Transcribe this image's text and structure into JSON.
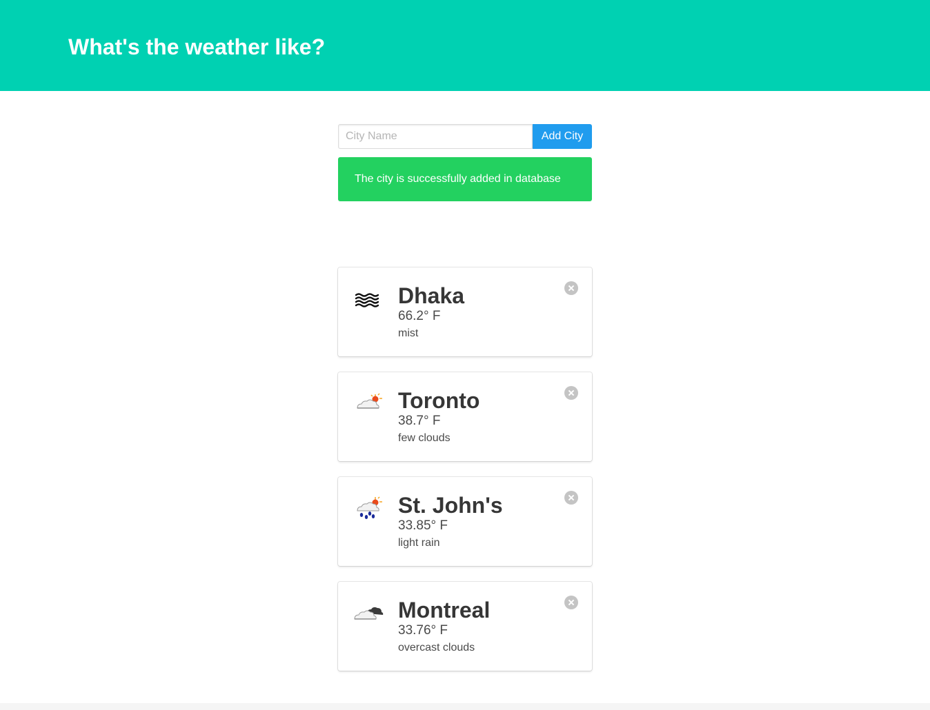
{
  "header": {
    "title": "What's the weather like?"
  },
  "form": {
    "placeholder": "City Name",
    "value": "",
    "submit_label": "Add City"
  },
  "notification": {
    "message": "The city is successfully added in database"
  },
  "cities": [
    {
      "name": "Dhaka",
      "temperature": "66.2° F",
      "description": "mist",
      "icon": "mist-icon"
    },
    {
      "name": "Toronto",
      "temperature": "38.7° F",
      "description": "few clouds",
      "icon": "few-clouds-icon"
    },
    {
      "name": "St. John's",
      "temperature": "33.85° F",
      "description": "light rain",
      "icon": "light-rain-icon"
    },
    {
      "name": "Montreal",
      "temperature": "33.76° F",
      "description": "overcast clouds",
      "icon": "overcast-clouds-icon"
    }
  ],
  "colors": {
    "hero": "#00d1b2",
    "button": "#209cee",
    "notification": "#23d160"
  }
}
